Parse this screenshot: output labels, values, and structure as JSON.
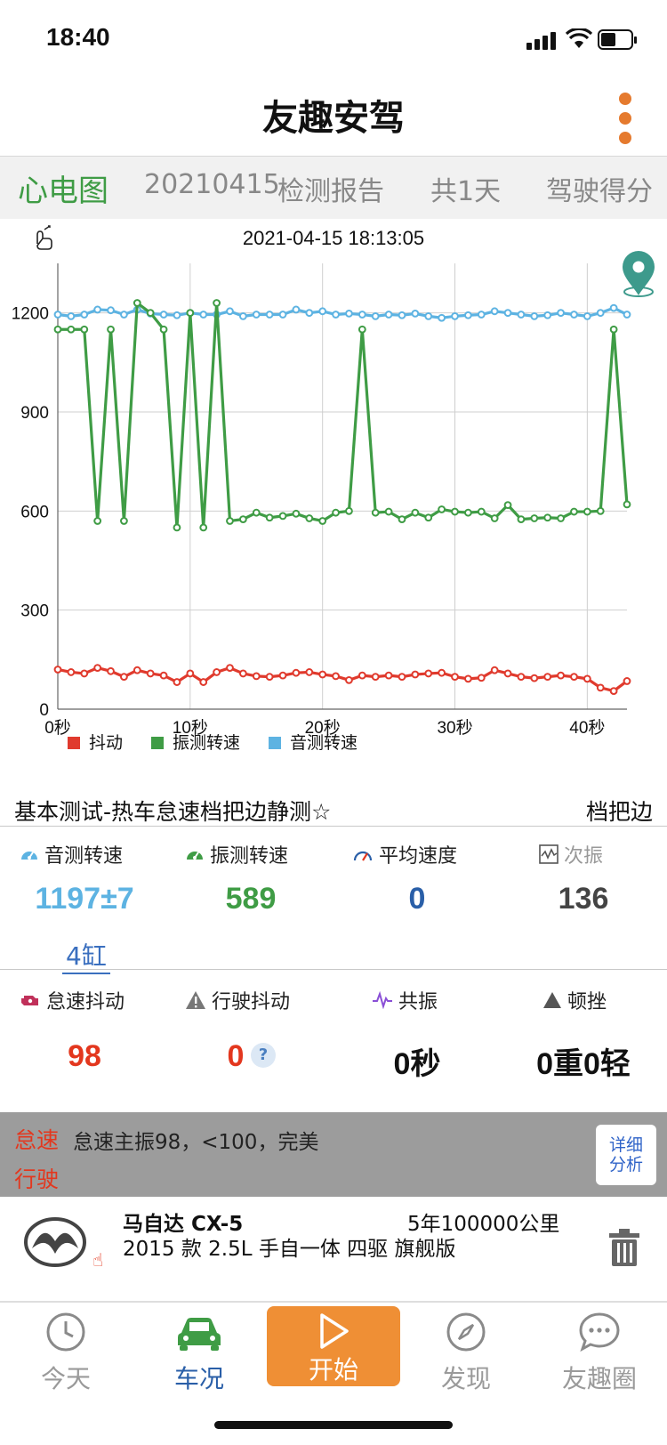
{
  "status": {
    "time": "18:40"
  },
  "header": {
    "title": "友趣安驾"
  },
  "tabs": [
    {
      "label": "心电图",
      "active": true
    },
    {
      "label": "20210415",
      "active": false
    },
    {
      "label": "检测报告",
      "active": false
    },
    {
      "label": "共1天",
      "active": false
    },
    {
      "label": "驾驶得分",
      "active": false
    }
  ],
  "chart_data": {
    "type": "line",
    "title": "2021-04-15 18:13:05",
    "xlabel": "",
    "ylabel": "",
    "x_ticks": [
      "0秒",
      "10秒",
      "20秒",
      "30秒",
      "40秒"
    ],
    "x_tick_values": [
      0,
      10,
      20,
      30,
      40
    ],
    "y_ticks": [
      0,
      300,
      600,
      900,
      1200
    ],
    "xlim": [
      0,
      43
    ],
    "ylim": [
      0,
      1350
    ],
    "grid": true,
    "legend_position": "bottom-left",
    "x": [
      0,
      1,
      2,
      3,
      4,
      5,
      6,
      7,
      8,
      9,
      10,
      11,
      12,
      13,
      14,
      15,
      16,
      17,
      18,
      19,
      20,
      21,
      22,
      23,
      24,
      25,
      26,
      27,
      28,
      29,
      30,
      31,
      32,
      33,
      34,
      35,
      36,
      37,
      38,
      39,
      40,
      41,
      42,
      43
    ],
    "series": [
      {
        "name": "抖动",
        "color": "#e03a2d",
        "values": [
          120,
          112,
          108,
          125,
          115,
          98,
          118,
          108,
          102,
          82,
          108,
          82,
          112,
          125,
          108,
          100,
          98,
          102,
          110,
          112,
          105,
          100,
          88,
          102,
          98,
          102,
          98,
          105,
          108,
          110,
          98,
          92,
          95,
          118,
          108,
          98,
          94,
          98,
          102,
          98,
          92,
          65,
          55,
          85
        ]
      },
      {
        "name": "振测转速",
        "color": "#3f9c45",
        "values": [
          1150,
          1150,
          1150,
          570,
          1150,
          570,
          1230,
          1200,
          1150,
          550,
          1200,
          550,
          1230,
          570,
          575,
          595,
          580,
          585,
          592,
          578,
          570,
          595,
          600,
          1150,
          595,
          598,
          575,
          595,
          580,
          605,
          598,
          595,
          598,
          578,
          618,
          575,
          578,
          580,
          578,
          598,
          598,
          600,
          1150,
          620
        ]
      },
      {
        "name": "音测转速",
        "color": "#5db3e2",
        "values": [
          1195,
          1190,
          1195,
          1210,
          1208,
          1195,
          1210,
          1198,
          1195,
          1193,
          1200,
          1195,
          1195,
          1205,
          1190,
          1195,
          1195,
          1195,
          1210,
          1200,
          1205,
          1195,
          1198,
          1195,
          1190,
          1195,
          1193,
          1198,
          1190,
          1185,
          1190,
          1193,
          1195,
          1205,
          1200,
          1195,
          1190,
          1193,
          1200,
          1195,
          1190,
          1200,
          1215,
          1195
        ]
      }
    ]
  },
  "test": {
    "title": "基本测试-热车怠速档把边静测☆",
    "side": "档把边"
  },
  "metrics": {
    "row1": [
      {
        "label": "音测转速",
        "value": "1197±7",
        "color": "#5db3e2",
        "icon": "gauge-icon"
      },
      {
        "label": "振测转速",
        "value": "589",
        "color": "#3f9c45",
        "icon": "gauge-icon"
      },
      {
        "label": "平均速度",
        "value": "0",
        "color": "#2a5fa8",
        "icon": "speedometer-icon"
      },
      {
        "label": "次振",
        "value": "136",
        "color": "#444444",
        "icon": "wave-chart-icon"
      }
    ],
    "cylinder": "4缸",
    "row2": [
      {
        "label": "怠速抖动",
        "value": "98",
        "color": "#e3371e",
        "icon": "engine-icon"
      },
      {
        "label": "行驶抖动",
        "value": "0",
        "color": "#e3371e",
        "icon": "warning-road-icon"
      },
      {
        "label": "共振",
        "value": "0秒",
        "color": "#111111",
        "icon": "pulse-icon"
      },
      {
        "label": "顿挫",
        "value": "0重0轻",
        "color": "#111111",
        "icon": "triangle-icon"
      }
    ],
    "help_mark": "?"
  },
  "analysis": {
    "label1": "怠速",
    "text1": "怠速主振98，<100，完美",
    "label2": "行驶",
    "detail_line1": "详细",
    "detail_line2": "分析"
  },
  "car": {
    "name": "马自达 CX-5",
    "mileage": "5年100000公里",
    "spec": "2015 款 2.5L 手自一体 四驱 旗舰版"
  },
  "nav": [
    {
      "label": "今天",
      "icon": "clock-icon"
    },
    {
      "label": "车况",
      "icon": "car-icon",
      "active": true
    },
    {
      "label": "开始",
      "icon": "play-icon"
    },
    {
      "label": "发现",
      "icon": "compass-icon"
    },
    {
      "label": "友趣圈",
      "icon": "chat-icon"
    }
  ]
}
